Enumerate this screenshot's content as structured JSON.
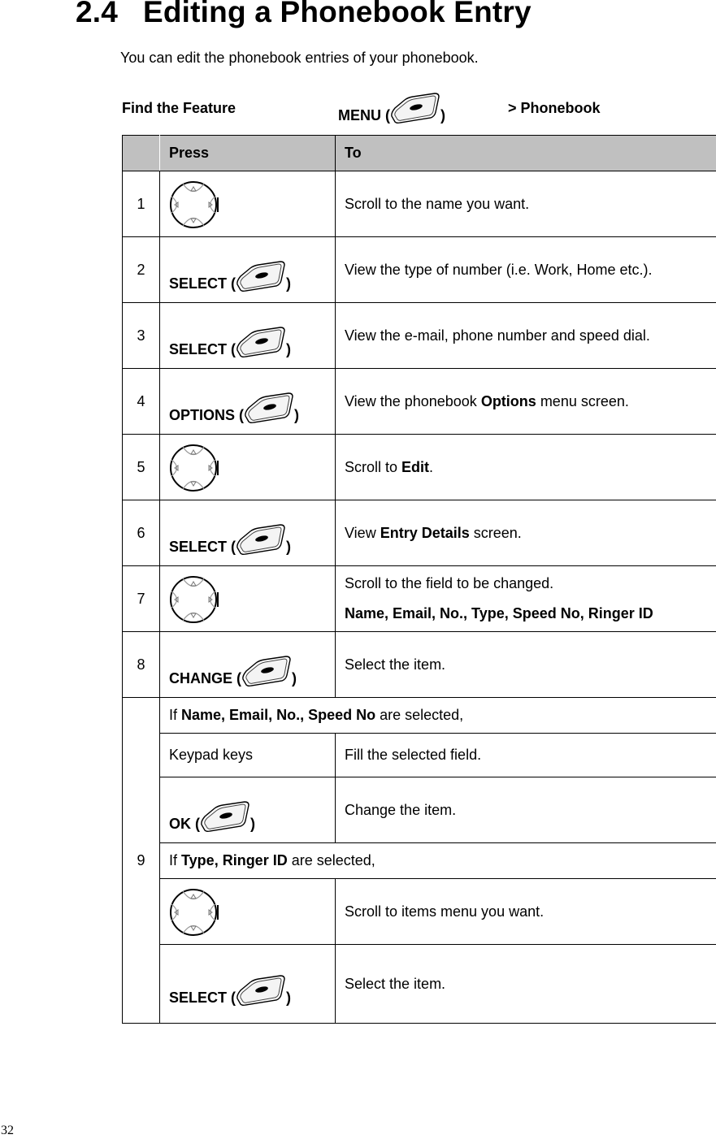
{
  "heading": {
    "number": "2.4",
    "title": "Editing a Phonebook Entry"
  },
  "intro": "You can edit the phonebook entries of your phonebook.",
  "find_feature": {
    "label": "Find the Feature",
    "menu_label": "MENU (",
    "menu_close": ")",
    "menu_icon": "soft-key-icon",
    "path": "> Phonebook"
  },
  "table": {
    "headers": [
      "",
      "Press",
      "To"
    ],
    "rows": [
      {
        "step": "1",
        "press_icon": "nav-key-icon",
        "to": "Scroll to the name you want."
      },
      {
        "step": "2",
        "press_label": "SELECT (",
        "press_close": ")",
        "press_icon": "soft-key-icon",
        "to": "View the type of number (i.e. Work, Home etc.)."
      },
      {
        "step": "3",
        "press_label": "SELECT (",
        "press_close": ")",
        "press_icon": "soft-key-icon",
        "to": "View the e-mail, phone number and speed dial."
      },
      {
        "step": "4",
        "press_label": "OPTIONS (",
        "press_close": ")",
        "press_icon": "soft-key-icon",
        "to_pre": "View the phonebook ",
        "to_bold": "Options",
        "to_post": " menu screen."
      },
      {
        "step": "5",
        "press_icon": "nav-key-icon",
        "to_pre": "Scroll to ",
        "to_bold": "Edit",
        "to_post": "."
      },
      {
        "step": "6",
        "press_label": "SELECT (",
        "press_close": ")",
        "press_icon": "soft-key-icon",
        "to_pre": "View ",
        "to_bold": "Entry Details",
        "to_post": " screen."
      },
      {
        "step": "7",
        "press_icon": "nav-key-icon",
        "to": "Scroll to the field to be changed.",
        "to_line2": "Name, Email, No., Type, Speed No, Ringer ID"
      },
      {
        "step": "8",
        "press_label": "CHANGE (",
        "press_close": ")",
        "press_icon": "soft-key-icon",
        "to": "Select the item."
      }
    ],
    "step9": {
      "step": "9",
      "cond1": {
        "pre": "If ",
        "bold": "Name, Email, No., Speed No",
        "post": " are selected,"
      },
      "cond1_rows": [
        {
          "press": "Keypad keys",
          "to": "Fill the selected field."
        },
        {
          "press_label": "OK (",
          "press_close": ")",
          "press_icon": "soft-key-icon",
          "to": "Change the item."
        }
      ],
      "cond2": {
        "pre": "If ",
        "bold": "Type, Ringer ID",
        "post": " are selected,"
      },
      "cond2_rows": [
        {
          "press_icon": "nav-key-icon",
          "to": "Scroll to items menu you want."
        },
        {
          "press_label": "SELECT (",
          "press_close": ")",
          "press_icon": "soft-key-icon",
          "to": "Select the item."
        }
      ]
    }
  },
  "page_number": "32"
}
